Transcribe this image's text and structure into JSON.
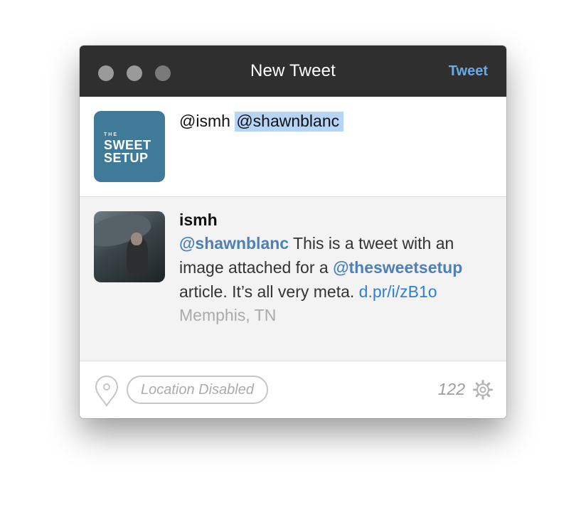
{
  "window": {
    "title": "New Tweet",
    "tweet_button": "Tweet",
    "traffic_lights": [
      "close",
      "minimize",
      "zoom"
    ]
  },
  "compose": {
    "avatar_logo": {
      "small": "THE",
      "line1": "SWEET",
      "line2": "SETUP"
    },
    "text_prefix": "@ismh ",
    "selected_mention": "@shawnblanc"
  },
  "quoted_tweet": {
    "author": "ismh",
    "mention1": "@shawnblanc",
    "text1": " This is a tweet with an image attached for a ",
    "mention2": "@thesweetsetup",
    "text2": " article. It’s all very meta. ",
    "link": "d.pr/i/zB1o",
    "location": "Memphis, TN"
  },
  "footer": {
    "location_pill": "Location Disabled",
    "char_count": "122",
    "icons": [
      "location-pin-icon",
      "gear-icon"
    ]
  },
  "colors": {
    "titlebar": "#2f2f2f",
    "tweet_button": "#6aa9e8",
    "mention": "#4d7fb8",
    "link": "#2f7fd7",
    "selection": "#b5d5f7"
  }
}
